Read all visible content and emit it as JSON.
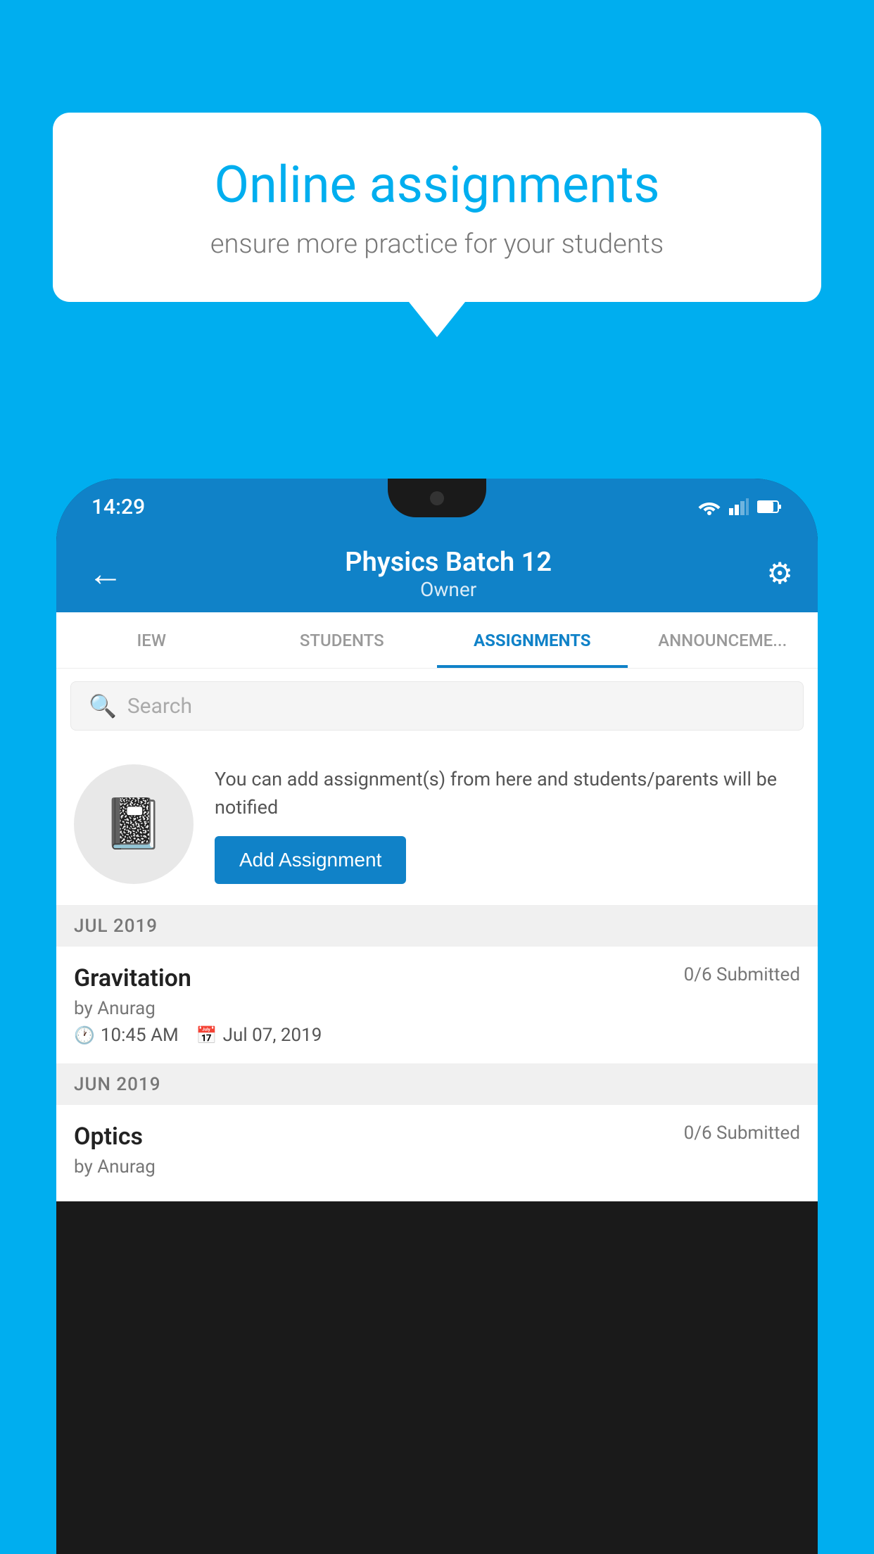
{
  "background_color": "#00AEEF",
  "speech_bubble": {
    "title": "Online assignments",
    "subtitle": "ensure more practice for your students"
  },
  "status_bar": {
    "time": "14:29"
  },
  "app_bar": {
    "title": "Physics Batch 12",
    "subtitle": "Owner",
    "back_label": "←",
    "settings_label": "⚙"
  },
  "tabs": [
    {
      "id": "iew",
      "label": "IEW",
      "active": false
    },
    {
      "id": "students",
      "label": "STUDENTS",
      "active": false
    },
    {
      "id": "assignments",
      "label": "ASSIGNMENTS",
      "active": true
    },
    {
      "id": "announcements",
      "label": "ANNOUNCEMENTS",
      "active": false
    }
  ],
  "search": {
    "placeholder": "Search"
  },
  "promo": {
    "text": "You can add assignment(s) from here and students/parents will be notified",
    "button_label": "Add Assignment"
  },
  "sections": [
    {
      "label": "JUL 2019",
      "items": [
        {
          "name": "Gravitation",
          "submitted": "0/6 Submitted",
          "author": "by Anurag",
          "time": "10:45 AM",
          "date": "Jul 07, 2019"
        }
      ]
    },
    {
      "label": "JUN 2019",
      "items": [
        {
          "name": "Optics",
          "submitted": "0/6 Submitted",
          "author": "by Anurag",
          "time": "",
          "date": ""
        }
      ]
    }
  ]
}
